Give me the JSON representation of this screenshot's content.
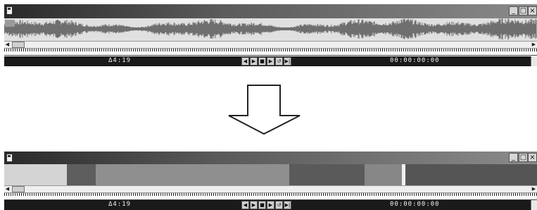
{
  "top_window": {
    "duration_readout": "Δ4:19",
    "timecode": "00:00:00:00"
  },
  "bottom_window": {
    "duration_readout": "Δ4:19",
    "timecode": "00:00:00:00",
    "segments": [
      {
        "start": 0.0,
        "end": 0.118,
        "color": "#d4d4d4"
      },
      {
        "start": 0.118,
        "end": 0.172,
        "color": "#5e5e5e"
      },
      {
        "start": 0.172,
        "end": 0.535,
        "color": "#8f8f8f"
      },
      {
        "start": 0.535,
        "end": 0.676,
        "color": "#5a5a5a"
      },
      {
        "start": 0.676,
        "end": 0.746,
        "color": "#878787"
      },
      {
        "start": 0.746,
        "end": 0.753,
        "color": "#f0f0f0"
      },
      {
        "start": 0.753,
        "end": 1.0,
        "color": "#555555"
      }
    ]
  },
  "window_buttons": {
    "minimize": "_",
    "maximize": "□",
    "close": "×"
  },
  "transport_glyphs": {
    "rewind": "◀",
    "forward": "▶",
    "stop": "■",
    "play": "▶",
    "loop": "↺",
    "end": "▶|"
  },
  "scroll_glyphs": {
    "left": "◀",
    "right": "▶"
  },
  "colors": {
    "statusbar": "#1a1a1a",
    "titlebar_dark": "#2a2a2a",
    "waveform": "#6f6f6f"
  }
}
